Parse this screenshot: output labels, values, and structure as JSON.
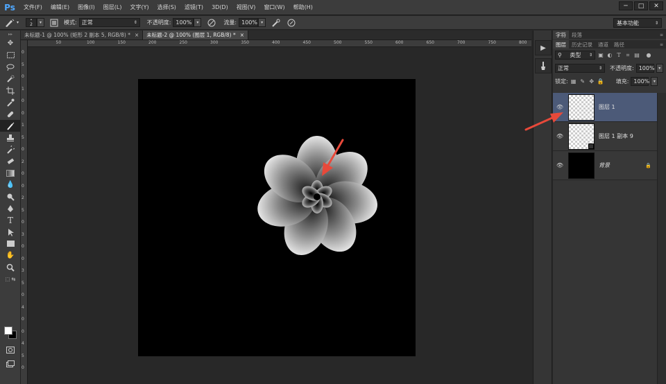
{
  "app": {
    "logo": "Ps"
  },
  "menu": [
    "文件(F)",
    "编辑(E)",
    "图像(I)",
    "图层(L)",
    "文字(Y)",
    "选择(S)",
    "滤镜(T)",
    "3D(D)",
    "视图(V)",
    "窗口(W)",
    "帮助(H)"
  ],
  "window_buttons": [
    "─",
    "□",
    "✕"
  ],
  "options": {
    "brush_size": "2",
    "mode_label": "模式:",
    "mode_value": "正常",
    "opacity_label": "不透明度:",
    "opacity_value": "100%",
    "flow_label": "流量:",
    "flow_value": "100%",
    "workspace": "基本功能"
  },
  "tabs": [
    {
      "label": "未标题-1 @ 100% (矩形 2 副本 5, RGB/8) *",
      "close": "×"
    },
    {
      "label": "未标题-2 @ 100% (图层 1, RGB/8) *",
      "close": "×"
    }
  ],
  "ruler_h": [
    "0",
    "50",
    "100",
    "150",
    "200",
    "250",
    "300",
    "350",
    "400",
    "450",
    "500",
    "550",
    "600",
    "650",
    "700",
    "750",
    "800"
  ],
  "ruler_v": [
    "0",
    "5",
    "0",
    "1",
    "0",
    "0",
    "1",
    "5",
    "0",
    "2",
    "0",
    "0",
    "2",
    "5",
    "0",
    "3",
    "0",
    "0",
    "3",
    "5",
    "0",
    "4",
    "0",
    "0",
    "4",
    "5",
    "0"
  ],
  "panel": {
    "top_tabs": [
      "字符",
      "段落"
    ],
    "layer_tabs": [
      "图层",
      "历史记录",
      "通道",
      "路径"
    ],
    "filter_label": "类型",
    "blend_mode": "正常",
    "opacity_label": "不透明度:",
    "opacity_value": "100%",
    "lock_label": "锁定:",
    "fill_label": "填充:",
    "fill_value": "100%",
    "layers": [
      {
        "name": "图层 1",
        "selected": true
      },
      {
        "name": "图层 1 副本 9",
        "selected": false
      },
      {
        "name": "背景",
        "selected": false
      }
    ]
  },
  "colors": {
    "annotation_arrow": "#e8493a",
    "selected_layer": "#4c5a78",
    "ps_blue": "#4fa8ff"
  }
}
